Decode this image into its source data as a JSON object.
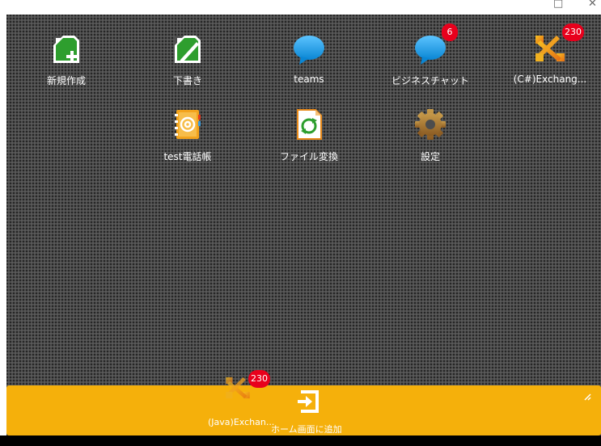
{
  "window": {
    "maximize_glyph": "□",
    "close_glyph": "✕"
  },
  "apps": [
    {
      "label": "新規作成",
      "icon": "new-document-icon"
    },
    {
      "label": "下書き",
      "icon": "draft-icon"
    },
    {
      "label": "teams",
      "icon": "chat-bubble-icon"
    },
    {
      "label": "ビジネスチャット",
      "icon": "chat-bubble-icon",
      "badge": "6"
    },
    {
      "label": "(C#)Exchang...",
      "icon": "exchange-icon",
      "badge": "230"
    },
    {
      "label": "test電話帳",
      "icon": "address-book-icon"
    },
    {
      "label": "ファイル変換",
      "icon": "file-convert-icon"
    },
    {
      "label": "設定",
      "icon": "gear-icon"
    }
  ],
  "dock": {
    "exchange_app": {
      "label": "(Java)Exchan...",
      "badge": "230",
      "icon": "exchange-icon"
    },
    "add_home": {
      "label": "ホーム画面に追加",
      "icon": "add-to-home-icon"
    }
  },
  "colors": {
    "dock": "#f5b00b",
    "badge": "#e8001c",
    "desktop": "#4d4d4d",
    "green": "#2e9e2e",
    "blue": "#1e9be6"
  }
}
